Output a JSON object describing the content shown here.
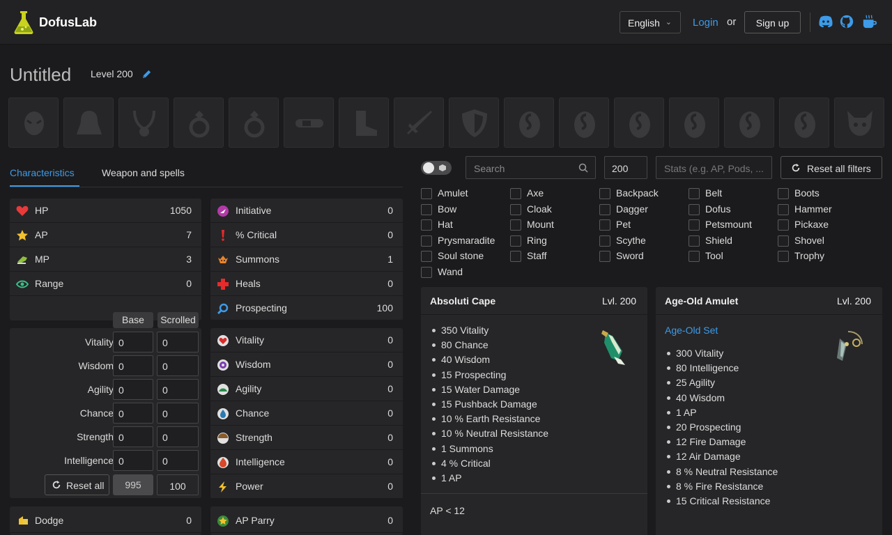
{
  "header": {
    "app_name": "DofusLab",
    "language": "English",
    "login": "Login",
    "or": "or",
    "signup": "Sign up",
    "icons": [
      "discord-icon",
      "github-icon",
      "coffee-icon"
    ]
  },
  "build": {
    "title": "Untitled",
    "level": "Level 200",
    "equipment_slots": [
      "hat",
      "cloak",
      "amulet",
      "ring",
      "ring",
      "belt",
      "boots",
      "weapon",
      "shield",
      "dofus",
      "dofus",
      "dofus",
      "dofus",
      "dofus",
      "dofus",
      "pet"
    ]
  },
  "tabs": [
    "Characteristics",
    "Weapon and spells"
  ],
  "main_stats": [
    {
      "label": "HP",
      "value": "1050",
      "icon": "heart-icon"
    },
    {
      "label": "AP",
      "value": "7",
      "icon": "star-icon"
    },
    {
      "label": "MP",
      "value": "3",
      "icon": "boot-icon"
    },
    {
      "label": "Range",
      "value": "0",
      "icon": "eye-icon"
    }
  ],
  "misc_stats": [
    {
      "label": "Initiative",
      "value": "0",
      "icon": "initiative-icon"
    },
    {
      "label": "% Critical",
      "value": "0",
      "icon": "critical-icon"
    },
    {
      "label": "Summons",
      "value": "1",
      "icon": "summons-icon"
    },
    {
      "label": "Heals",
      "value": "0",
      "icon": "heal-cross-icon"
    },
    {
      "label": "Prospecting",
      "value": "100",
      "icon": "prospecting-icon"
    }
  ],
  "scroll_headers": {
    "base": "Base",
    "scrolled": "Scrolled"
  },
  "base_stats": [
    {
      "label": "Vitality",
      "base": "0",
      "scrolled": "0"
    },
    {
      "label": "Wisdom",
      "base": "0",
      "scrolled": "0"
    },
    {
      "label": "Agility",
      "base": "0",
      "scrolled": "0"
    },
    {
      "label": "Chance",
      "base": "0",
      "scrolled": "0"
    },
    {
      "label": "Strength",
      "base": "0",
      "scrolled": "0"
    },
    {
      "label": "Intelligence",
      "base": "0",
      "scrolled": "0"
    }
  ],
  "reset_all": "Reset all",
  "points_remaining": "995",
  "scroll_cap": "100",
  "elem_stats": [
    {
      "label": "Vitality",
      "value": "0",
      "icon": "vitality-icon"
    },
    {
      "label": "Wisdom",
      "value": "0",
      "icon": "wisdom-icon"
    },
    {
      "label": "Agility",
      "value": "0",
      "icon": "agility-icon"
    },
    {
      "label": "Chance",
      "value": "0",
      "icon": "chance-icon"
    },
    {
      "label": "Strength",
      "value": "0",
      "icon": "strength-icon"
    },
    {
      "label": "Intelligence",
      "value": "0",
      "icon": "intelligence-icon"
    },
    {
      "label": "Power",
      "value": "0",
      "icon": "power-icon"
    }
  ],
  "bottom_stats": [
    {
      "label": "Dodge",
      "value": "0",
      "icon": "dodge-icon"
    },
    {
      "label": "AP Parry",
      "value": "0",
      "icon": "ap-parry-icon"
    }
  ],
  "filters": {
    "search_placeholder": "Search",
    "level": "200",
    "stats_placeholder": "Stats (e.g. AP, Pods, ...",
    "reset": "Reset all filters",
    "types": [
      "Amulet",
      "Axe",
      "Backpack",
      "Belt",
      "Boots",
      "Bow",
      "Cloak",
      "Dagger",
      "Dofus",
      "Hammer",
      "Hat",
      "Mount",
      "Pet",
      "Petsmount",
      "Pickaxe",
      "Prysmaradite",
      "Ring",
      "Scythe",
      "Shield",
      "Shovel",
      "Soul stone",
      "Staff",
      "Sword",
      "Tool",
      "Trophy",
      "Wand"
    ]
  },
  "items": [
    {
      "name": "Absoluti Cape",
      "level": "Lvl. 200",
      "set": "",
      "stats": [
        "350 Vitality",
        "80 Chance",
        "40 Wisdom",
        "15 Prospecting",
        "15 Water Damage",
        "15 Pushback Damage",
        "10 % Earth Resistance",
        "10 % Neutral Resistance",
        "1 Summons",
        "4 % Critical",
        "1 AP"
      ],
      "condition": "AP < 12"
    },
    {
      "name": "Age-Old Amulet",
      "level": "Lvl. 200",
      "set": "Age-Old Set",
      "stats": [
        "300 Vitality",
        "80 Intelligence",
        "25 Agility",
        "40 Wisdom",
        "1 AP",
        "20 Prospecting",
        "12 Fire Damage",
        "12 Air Damage",
        "8 % Neutral Resistance",
        "8 % Fire Resistance",
        "15 Critical Resistance"
      ],
      "condition": ""
    }
  ],
  "colors": {
    "accent": "#3d9be9",
    "background": "#1b1b1d",
    "panel": "#262628"
  }
}
